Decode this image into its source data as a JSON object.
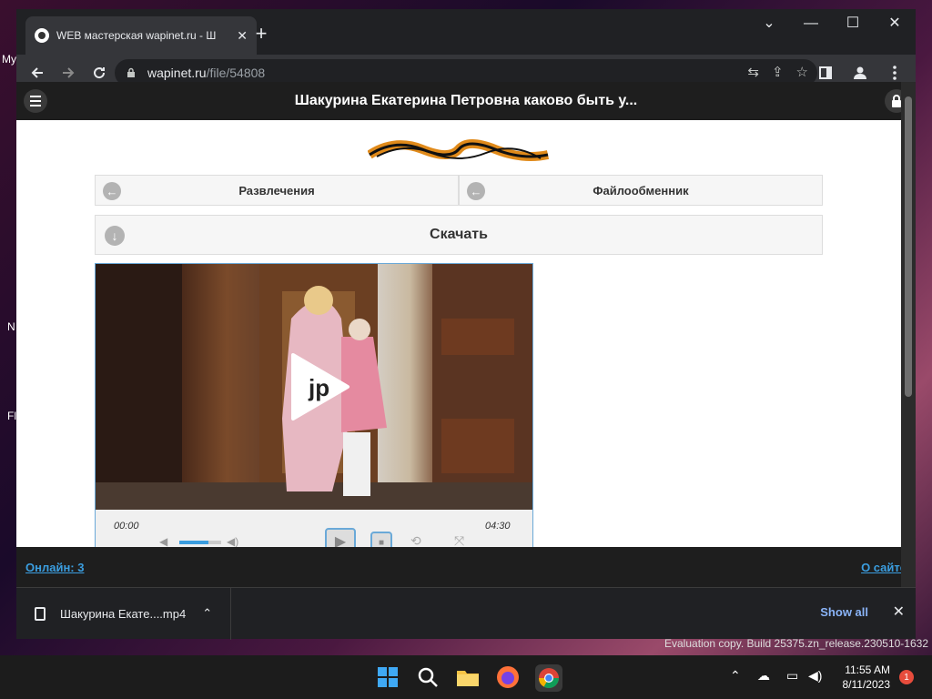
{
  "desktop": {
    "labels": [
      "My",
      "N",
      "Fl"
    ]
  },
  "browser": {
    "tab_title": "WEB мастерская wapinet.ru - Ш",
    "new_tab": "+",
    "url_host": "wapinet.ru",
    "url_path": "/file/54808",
    "window_controls": {
      "minimize": "—",
      "maximize": "☐",
      "close": "✕",
      "tab_search": "⌄"
    }
  },
  "site": {
    "header_title": "Шакурина Екатерина Петровна каково быть у...",
    "nav_back_1": "Развлечения",
    "nav_back_2": "Файлообменник",
    "download": "Скачать",
    "player": {
      "time_current": "00:00",
      "time_total": "04:30",
      "volume": 0.7
    },
    "footer_left": "Онлайн: 3",
    "footer_right": "О сайте"
  },
  "downloads": {
    "file_name": "Шакурина Екате....mp4",
    "show_all": "Show all"
  },
  "watermark": "Evaluation copy. Build 25375.zn_release.230510-1632",
  "taskbar": {
    "time": "11:55 AM",
    "date": "8/11/2023",
    "notification_count": "1"
  },
  "colors": {
    "link": "#3b9ee0",
    "chrome_bg": "#202124",
    "toolbar_bg": "#35363a",
    "player_border": "#6aa9d8"
  }
}
